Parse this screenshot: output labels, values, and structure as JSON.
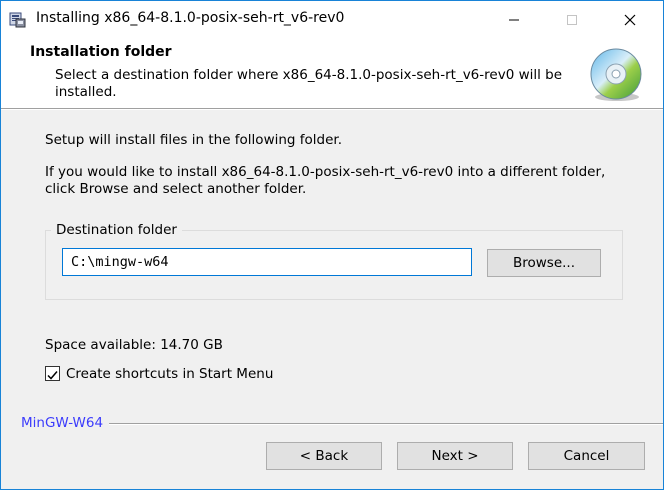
{
  "window": {
    "title": "Installing x86_64-8.1.0-posix-seh-rt_v6-rev0",
    "accent_color": "#1883d7"
  },
  "header": {
    "title": "Installation folder",
    "description": "Select a destination folder where x86_64-8.1.0-posix-seh-rt_v6-rev0 will be installed.",
    "icon": "cd-icon"
  },
  "body": {
    "intro": "Setup will install files in the following folder.",
    "instructions": "If you would like to install x86_64-8.1.0-posix-seh-rt_v6-rev0 into a different folder, click Browse and select another folder.",
    "destination_group_label": "Destination folder",
    "destination_path": "C:\\mingw-w64",
    "browse_label": "Browse...",
    "space_available": "Space available: 14.70 GB",
    "create_shortcuts_label": "Create shortcuts in Start Menu",
    "create_shortcuts_checked": true
  },
  "footer": {
    "brand": "MinGW-W64",
    "brand_color": "#3c3cfc",
    "back_label": "< Back",
    "next_label": "Next >",
    "cancel_label": "Cancel"
  }
}
